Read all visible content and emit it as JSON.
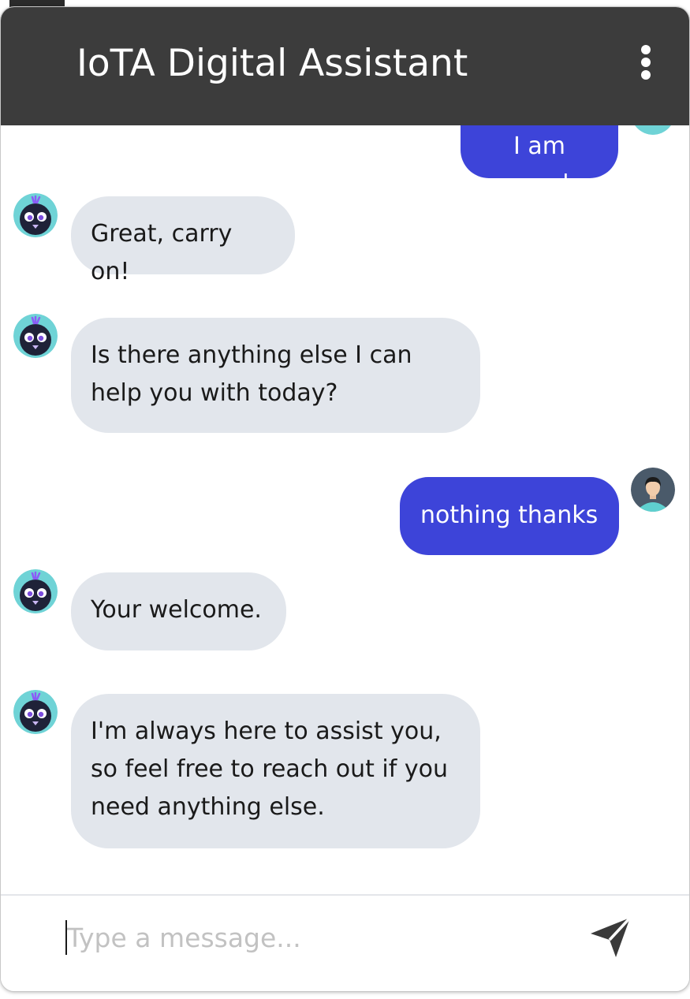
{
  "header": {
    "title": "IoTA Digital Assistant",
    "menu_icon": "more-vertical-icon"
  },
  "messages": [
    {
      "sender": "user",
      "text": "I am good"
    },
    {
      "sender": "bot",
      "text": "Great, carry on!"
    },
    {
      "sender": "bot",
      "text": "Is there anything else I can help you with today?"
    },
    {
      "sender": "user",
      "text": "nothing thanks"
    },
    {
      "sender": "bot",
      "text": "Your welcome."
    },
    {
      "sender": "bot",
      "text": "I'm always here to assist you, so feel free to reach out if you need anything else."
    }
  ],
  "composer": {
    "placeholder": "Type a message...",
    "value": "",
    "send_icon": "send-icon"
  },
  "colors": {
    "header_bg": "#3c3c3c",
    "user_bubble": "#3d44d9",
    "bot_bubble": "#e2e6ec",
    "avatar_teal": "#6fd3d6"
  }
}
